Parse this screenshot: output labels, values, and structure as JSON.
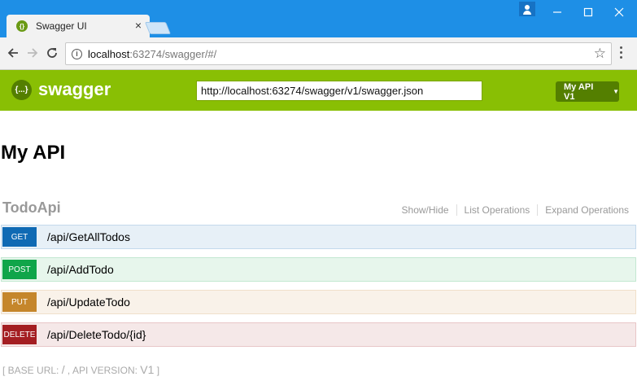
{
  "browser": {
    "tab_title": "Swagger UI",
    "tab_close": "×",
    "address_host": "localhost",
    "address_path": ":63274/swagger/#/",
    "icons": [
      "swagger-favicon",
      "user-icon",
      "minimize-icon",
      "maximize-icon",
      "close-icon",
      "back-icon",
      "forward-icon",
      "reload-icon",
      "info-icon",
      "star-icon",
      "menu-icon"
    ]
  },
  "header": {
    "logo_mark": "{...}",
    "logo_text": "swagger",
    "spec_url": "http://localhost:63274/swagger/v1/swagger.json",
    "spec_select": "My API V1",
    "colors": {
      "header_bg": "#89bf04",
      "select_bg": "#547f00"
    }
  },
  "api": {
    "title": "My API"
  },
  "resource": {
    "name": "TodoApi",
    "show_hide": "Show/Hide",
    "list_ops": "List Operations",
    "expand_ops": "Expand Operations"
  },
  "operations": [
    {
      "method": "GET",
      "path": "/api/GetAllTodos",
      "color": "#0f6ab4"
    },
    {
      "method": "POST",
      "path": "/api/AddTodo",
      "color": "#10a54a"
    },
    {
      "method": "PUT",
      "path": "/api/UpdateTodo",
      "color": "#c5862b"
    },
    {
      "method": "DELETE",
      "path": "/api/DeleteTodo/{id}",
      "color": "#a41e22"
    }
  ],
  "footer": {
    "open": "[ ",
    "base_url_label": "BASE URL",
    "base_url_value": "/",
    "api_version_label": "API VERSION",
    "api_version_value": "V1",
    "close": " ]"
  }
}
